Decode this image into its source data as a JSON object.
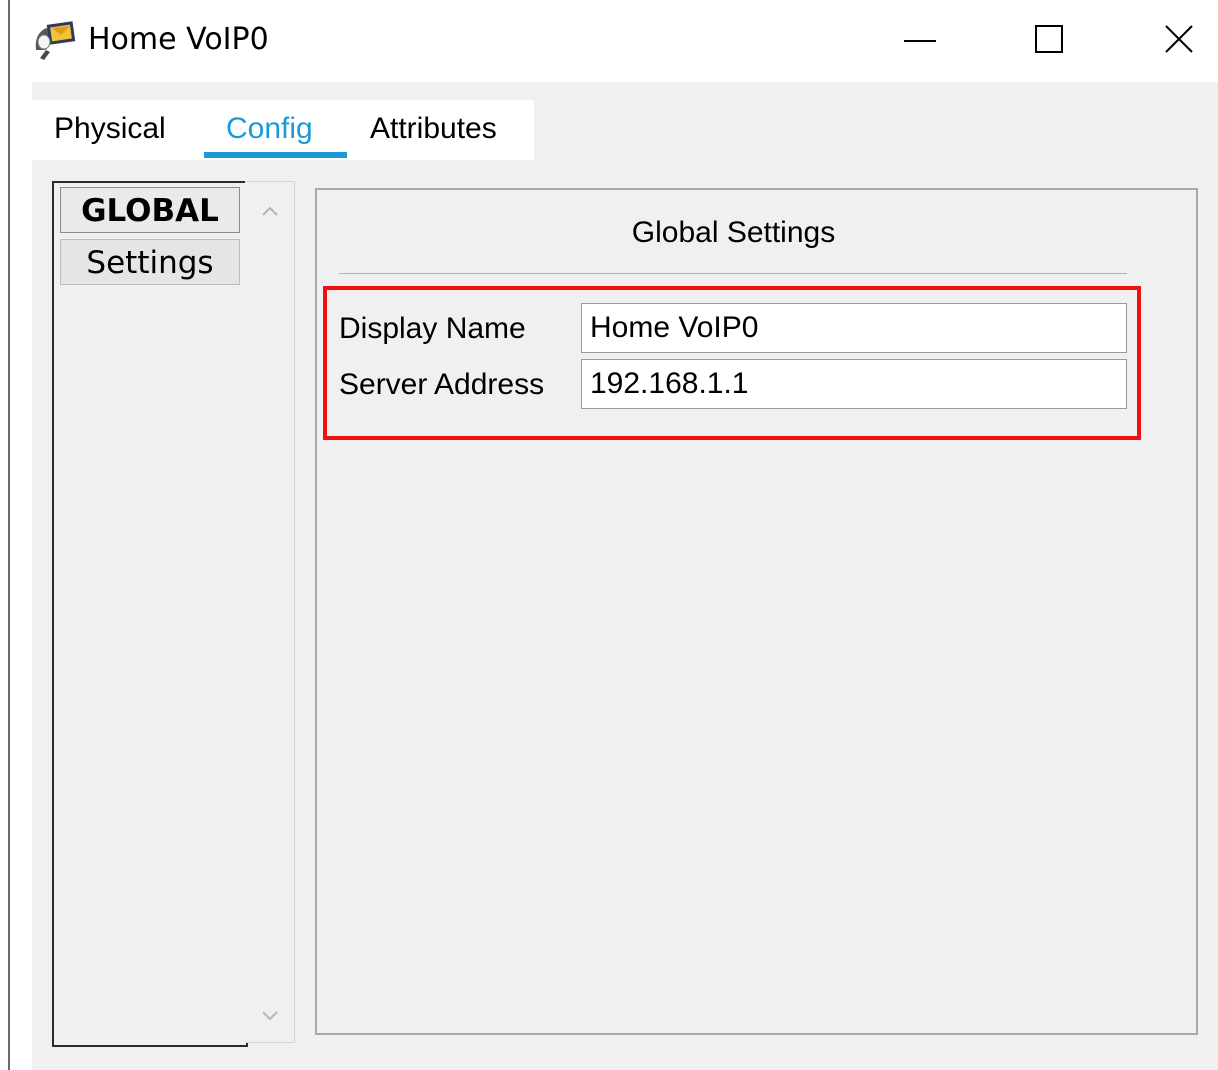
{
  "window": {
    "title": "Home VoIP0"
  },
  "tabs": [
    {
      "label": "Physical",
      "active": false
    },
    {
      "label": "Config",
      "active": true
    },
    {
      "label": "Attributes",
      "active": false
    }
  ],
  "nav": {
    "items": [
      {
        "label": "GLOBAL"
      },
      {
        "label": "Settings"
      }
    ]
  },
  "panel": {
    "heading": "Global Settings",
    "fields": [
      {
        "label": "Display Name",
        "value": "Home VoIP0"
      },
      {
        "label": "Server Address",
        "value": "192.168.1.1"
      }
    ]
  },
  "colors": {
    "accent": "#1a9ad6",
    "highlight": "#ee1111",
    "panel_bg": "#f0f0f0"
  },
  "icons": {
    "app": "voip-device-icon",
    "minimize": "minimize-icon",
    "maximize": "maximize-icon",
    "close": "close-icon",
    "scroll_up": "chevron-up-icon",
    "scroll_down": "chevron-down-icon"
  }
}
